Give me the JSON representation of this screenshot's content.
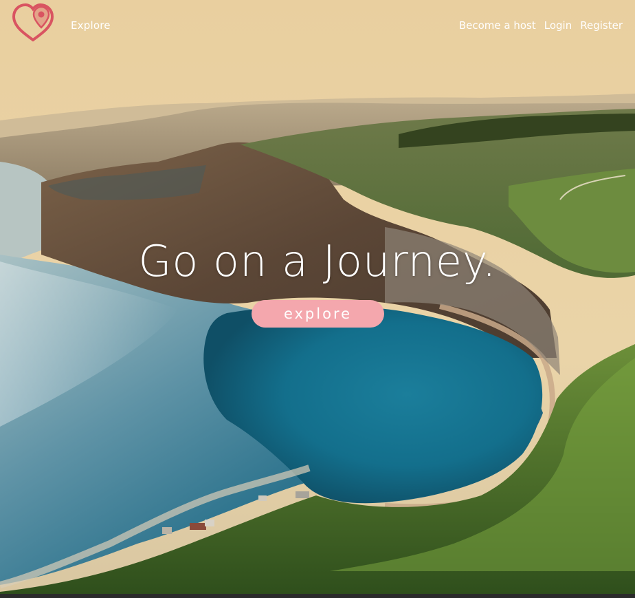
{
  "nav": {
    "logo_icon": "location-heart-icon",
    "explore_label": "Explore",
    "become_host_label": "Become a host",
    "login_label": "Login",
    "register_label": "Register"
  },
  "hero": {
    "headline": "Go on a Journey.",
    "cta_label": "explore",
    "background": "coastal-cliffs-bay-photo"
  },
  "colors": {
    "accent": "#f4a7ad",
    "logo": "#e35d6a",
    "text": "#ffffff"
  }
}
